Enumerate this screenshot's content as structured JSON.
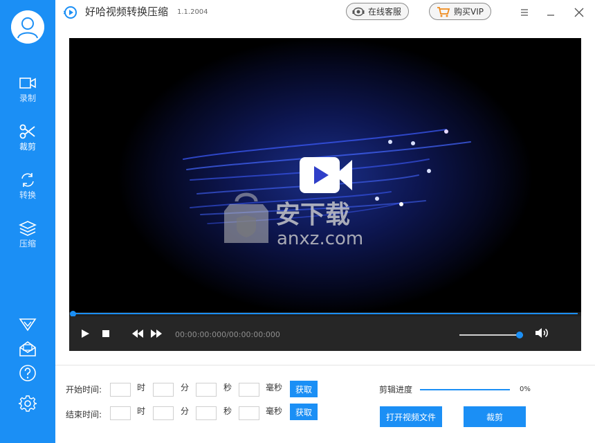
{
  "app": {
    "title": "好哈视频转换压缩",
    "version": "1.1.2004"
  },
  "header": {
    "service_label": "在线客服",
    "vip_label": "购买VIP"
  },
  "sidebar": {
    "items": [
      {
        "label": "录制",
        "icon": "record-icon"
      },
      {
        "label": "裁剪",
        "icon": "scissors-icon"
      },
      {
        "label": "转换",
        "icon": "convert-icon"
      },
      {
        "label": "压缩",
        "icon": "compress-icon"
      }
    ],
    "bottom_icons": [
      "diamond-icon",
      "mail-icon",
      "help-icon",
      "settings-icon"
    ]
  },
  "player": {
    "timecode": "00:00:00:000/00:00:00:000",
    "progress": 0,
    "volume": 0.95,
    "watermark_text": "安下载",
    "watermark_domain": "anxz.com"
  },
  "clip": {
    "start_label": "开始时间:",
    "end_label": "结束时间:",
    "units": {
      "hour": "时",
      "minute": "分",
      "second": "秒",
      "ms": "毫秒"
    },
    "start": {
      "hour": "",
      "minute": "",
      "second": "",
      "ms": ""
    },
    "end": {
      "hour": "",
      "minute": "",
      "second": "",
      "ms": ""
    },
    "get_label": "获取",
    "progress_label": "剪辑进度",
    "progress_value": "0%",
    "open_label": "打开视频文件",
    "cut_label": "裁剪"
  },
  "colors": {
    "accent": "#1b8ff5",
    "sidebar": "#1b8ff5",
    "controls": "#262626"
  }
}
